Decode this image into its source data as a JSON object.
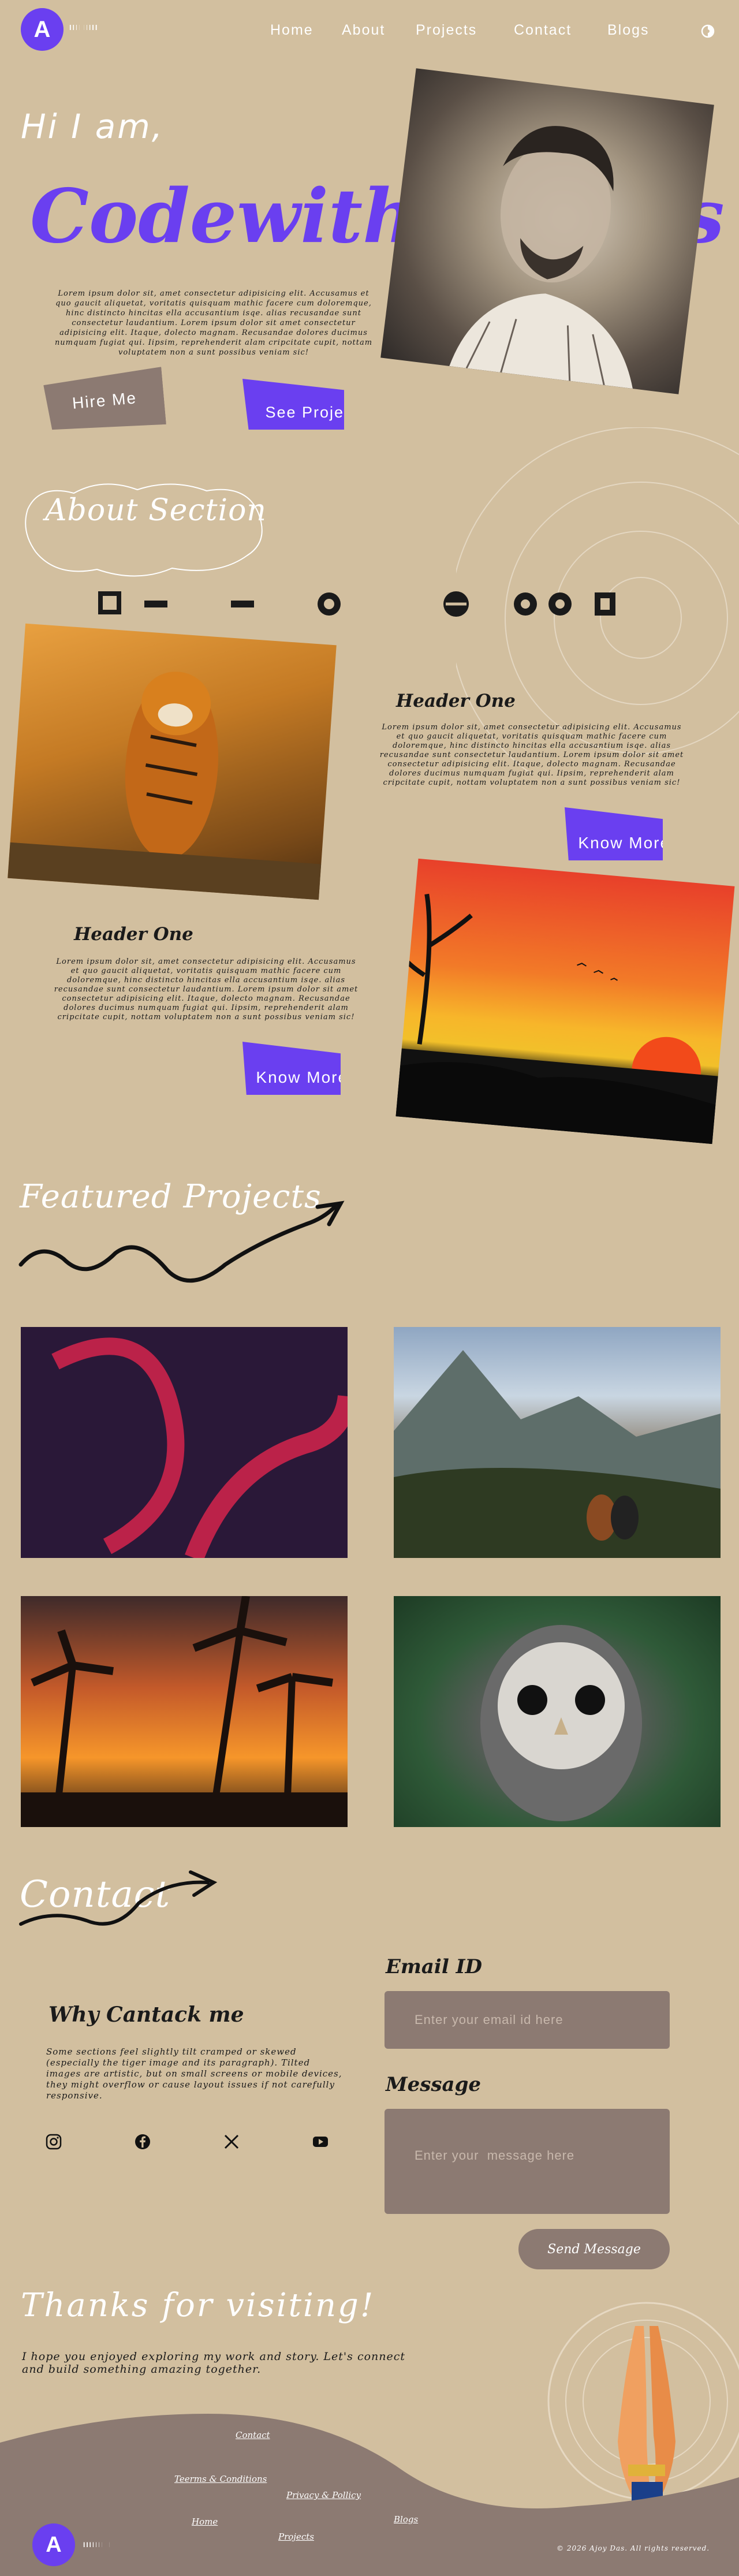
{
  "nav": {
    "logo_letter": "A",
    "logo_text": "IIIIIIIII",
    "links": [
      "Home",
      "About",
      "Projects",
      "Contact",
      "Blogs"
    ]
  },
  "hero": {
    "greeting": "Hi I am,",
    "name": "Codewithajoydas",
    "description": "Lorem ipsum dolor sit, amet consectetur adipisicing elit. Accusamus et quo gaucit aliquetat, voritatis quisquam mathic facere cum doloremque, hinc distincto hincitas ella accusantium isqe. alias recusandae sunt consectetur laudantium. Lorem ipsum dolor sit amet consectetur adipisicing elit. Itaque, dolecto magnam. Recusandae dolores ducimus numquam fugiat qui. Iipsim, reprehenderit alam cripcitate cupit, nottam voluptatem non a sunt possibus veniam sic!",
    "hire_label": "Hire Me",
    "projects_label": "See Projects"
  },
  "about": {
    "title": "About Section",
    "cards": [
      {
        "title": "Header One",
        "body": "Lorem ipsum dolor sit, amet consectetur adipisicing elit. Accusamus et quo gaucit aliquetat, voritatis quisquam mathic facere cum doloremque, hinc distincto hincitas ella accusantium isqe. alias recusandae sunt consectetur laudantium. Lorem ipsum dolor sit amet consectetur adipisicing elit. Itaque, dolecto magnam. Recusandae dolores ducimus numquam fugiat qui. Iipsim, reprehenderit alam cripcitate cupit, nottam voluptatem non a sunt possibus veniam sic!",
        "button": "Know More.."
      },
      {
        "title": "Header One",
        "body": "Lorem ipsum dolor sit, amet consectetur adipisicing elit. Accusamus et quo gaucit aliquetat, voritatis quisquam mathic facere cum doloremque, hinc distincto hincitas ella accusantium isqe. alias recusandae sunt consectetur laudantium. Lorem ipsum dolor sit amet consectetur adipisicing elit. Itaque, dolecto magnam. Recusandae dolores ducimus numquam fugiat qui. Iipsim, reprehenderit alam cripcitate cupit, nottam voluptatem non a sunt possibus veniam sic!",
        "button": "Know More.."
      }
    ]
  },
  "featured": {
    "title": "Featured Projects"
  },
  "contact": {
    "title": "Contact",
    "why_title": "Why Cantack me",
    "why_body": "Some sections feel slightly tilt cramped or skewed (especially the tiger image and its paragraph). Tilted images are artistic, but on small screens or mobile devices, they might overflow or cause layout issues if not carefully responsive.",
    "email_label": "Email ID",
    "email_placeholder": "Enter your email id here",
    "message_label": "Message",
    "message_placeholder": "Enter your  message here",
    "send_label": "Send Message"
  },
  "thanks": {
    "title": "Thanks for visiting!",
    "body": "I hope you enjoyed exploring my work and story. Let's connect and build something amazing together."
  },
  "footer": {
    "links": {
      "contact": "Contact",
      "terms": "Teerms & Conditions",
      "privacy": "Privacy & Pollicy",
      "projects": "Projects",
      "home": "Home",
      "blogs": "Blogs"
    },
    "logo_letter": "A",
    "logo_text": "IIIIIIIII",
    "copyright": "© 2026 Ajoy Das. All rights reserved."
  },
  "colors": {
    "background": "#d2bf9f",
    "accent": "#6a3ff0",
    "muted": "#8c7a72"
  },
  "icons": [
    "theme-toggle-icon",
    "instagram-icon",
    "facebook-icon",
    "x-icon",
    "youtube-icon"
  ]
}
